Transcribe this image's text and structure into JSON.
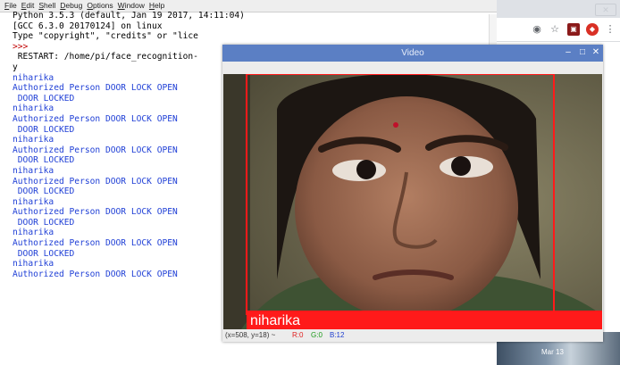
{
  "shell": {
    "menu": [
      "File",
      "Edit",
      "Shell",
      "Debug",
      "Options",
      "Window",
      "Help"
    ],
    "lines": [
      {
        "text": "Python 3.5.3 (default, Jan 19 2017, 14:11:04)",
        "color": "#000000"
      },
      {
        "text": "[GCC 6.3.0 20170124] on linux",
        "color": "#000000"
      },
      {
        "text": "Type \"copyright\", \"credits\" or \"lice",
        "color": "#000000"
      },
      {
        "text": ">>>",
        "color": "#c00000"
      },
      {
        "text": " RESTART: /home/pi/face_recognition-",
        "color": "#000000"
      },
      {
        "text": "y",
        "color": "#000000"
      },
      {
        "text": "niharika",
        "color": "#1f3fd6"
      },
      {
        "text": "Authorized Person DOOR LOCK OPEN",
        "color": "#1f3fd6"
      },
      {
        "text": " DOOR LOCKED",
        "color": "#1f3fd6"
      },
      {
        "text": "niharika",
        "color": "#1f3fd6"
      },
      {
        "text": "Authorized Person DOOR LOCK OPEN",
        "color": "#1f3fd6"
      },
      {
        "text": " DOOR LOCKED",
        "color": "#1f3fd6"
      },
      {
        "text": "niharika",
        "color": "#1f3fd6"
      },
      {
        "text": "Authorized Person DOOR LOCK OPEN",
        "color": "#1f3fd6"
      },
      {
        "text": " DOOR LOCKED",
        "color": "#1f3fd6"
      },
      {
        "text": "niharika",
        "color": "#1f3fd6"
      },
      {
        "text": "Authorized Person DOOR LOCK OPEN",
        "color": "#1f3fd6"
      },
      {
        "text": " DOOR LOCKED",
        "color": "#1f3fd6"
      },
      {
        "text": "niharika",
        "color": "#1f3fd6"
      },
      {
        "text": "Authorized Person DOOR LOCK OPEN",
        "color": "#1f3fd6"
      },
      {
        "text": " DOOR LOCKED",
        "color": "#1f3fd6"
      },
      {
        "text": "niharika",
        "color": "#1f3fd6"
      },
      {
        "text": "Authorized Person DOOR LOCK OPEN",
        "color": "#1f3fd6"
      },
      {
        "text": " DOOR LOCKED",
        "color": "#1f3fd6"
      },
      {
        "text": "niharika",
        "color": "#1f3fd6"
      },
      {
        "text": "Authorized Person DOOR LOCK OPEN",
        "color": "#1f3fd6"
      }
    ]
  },
  "video": {
    "title": "Video",
    "min_icon": "–",
    "max_icon": "□",
    "close_icon": "✕",
    "face_label": "niharika",
    "box_color": "#ff1a1a",
    "status": {
      "pos": "(x=508, y=18) ~",
      "r": "R:0",
      "g": "G:0",
      "b": "B:12"
    }
  },
  "browser": {
    "icons": [
      "eye-icon",
      "star-icon",
      "extension-icon",
      "shield-icon",
      "menu-icon"
    ],
    "clock": "Mar 13"
  }
}
